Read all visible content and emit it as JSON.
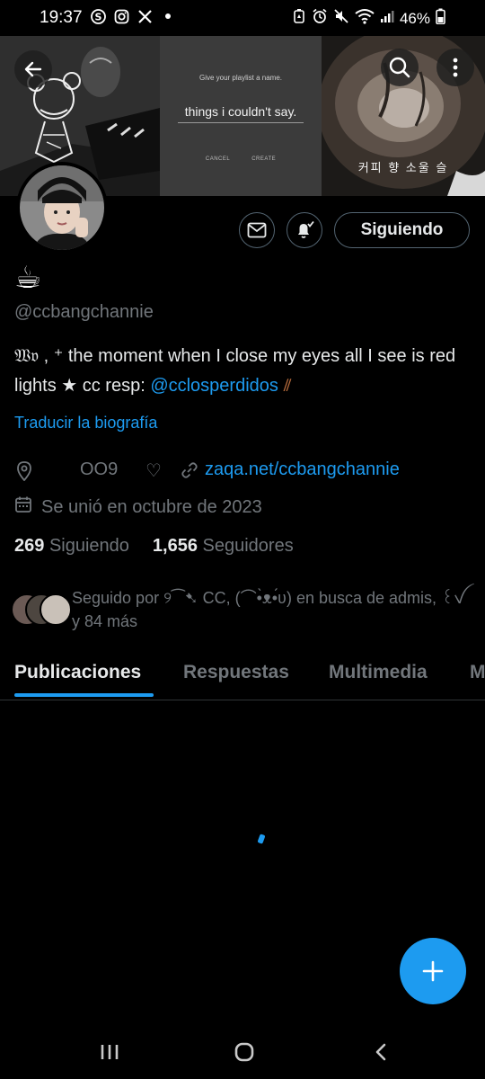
{
  "status_bar": {
    "time": "19:37",
    "battery": "46%",
    "left_icons": [
      "skype-icon",
      "instagram-icon",
      "x-icon",
      "dot-icon"
    ],
    "right_icons": [
      "battery-saver-icon",
      "alarm-icon",
      "mute-icon",
      "wifi-icon",
      "signal-icon",
      "battery-icon"
    ]
  },
  "banner": {
    "dialog_title": "Give your playlist a name.",
    "playlist_name": "things i couldn't say.",
    "cancel_label": "CANCEL",
    "create_label": "CREATE",
    "korean_caption": "커피 향 소울 슬"
  },
  "profile": {
    "display_name": "☕",
    "handle": "@ccbangchannie",
    "bio_prefix": "𝔚𝔳  ,   ⁺   the moment when I close my eyes all I see is red lights  ★ cc resp: ",
    "bio_mention": "@cclosperdidos",
    "bio_suffix": " ⫽",
    "translate_label": "Traducir la biografía",
    "location": "OO9",
    "heart_symbol": "♡",
    "website": "zaqa.net/ccbangchannie",
    "joined": "Se unió en octubre de 2023",
    "following_count": "269",
    "following_label": "Siguiendo",
    "followers_count": "1,656",
    "followers_label": "Seguidores",
    "followed_by_text": "Seguido por ୨⁀➷ CC, (⌒•̀ᴥ•́ʋ) en busca de admis, ꒰ꪜ y 84 más"
  },
  "actions": {
    "follow_button_label": "Siguiendo"
  },
  "tabs": [
    {
      "label": "Publicaciones",
      "active": true
    },
    {
      "label": "Respuestas",
      "active": false
    },
    {
      "label": "Multimedia",
      "active": false
    },
    {
      "label": "Me gusta",
      "active": false
    }
  ],
  "colors": {
    "accent": "#1d9bf0",
    "background": "#000000",
    "text": "#e7e9ea",
    "muted": "#71767b",
    "border": "#536471"
  }
}
